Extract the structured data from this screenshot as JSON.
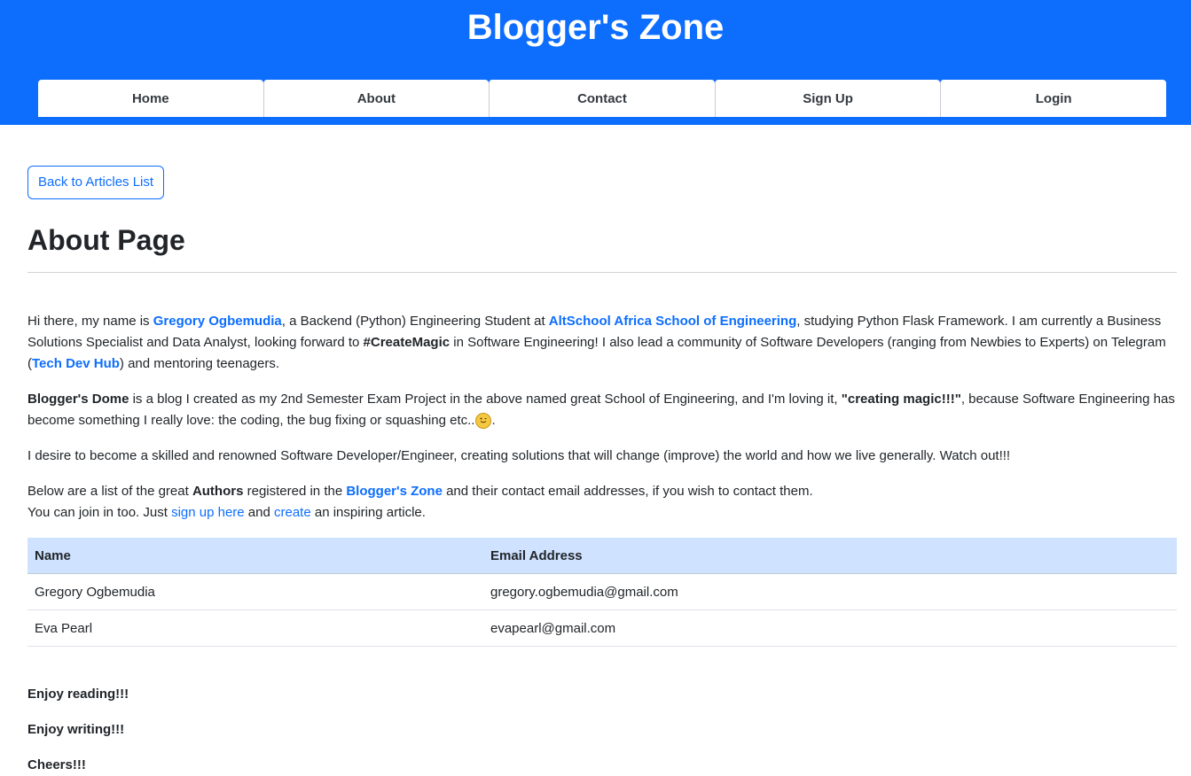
{
  "site": {
    "title": "Blogger's Zone",
    "brand_color": "#0d6efd"
  },
  "nav": {
    "items": [
      "Home",
      "About",
      "Contact",
      "Sign Up",
      "Login"
    ]
  },
  "back_button": "Back to Articles List",
  "page_title": "About Page",
  "intro": {
    "p1": {
      "t1": "Hi there, my name is ",
      "name_link": "Gregory Ogbemudia",
      "t2": ", a Backend (Python) Engineering Student at ",
      "school_link": "AltSchool Africa School of Engineering",
      "t3": ", studying Python Flask Framework. I am currently a Business Solutions Specialist and Data Analyst, looking forward to ",
      "hashtag": "#CreateMagic",
      "t4": " in Software Engineering! I also lead a community of Software Developers (ranging from Newbies to Experts) on Telegram (",
      "community_link": "Tech Dev Hub",
      "t5": ") and mentoring teenagers."
    },
    "p2": {
      "brand": "Blogger's Dome",
      "t1": " is a blog I created as my 2nd Semester Exam Project in the above named great School of Engineering, and I'm loving it, ",
      "quote": "\"creating magic!!!\"",
      "t2": ", because Software Engineering has become something I really love: the coding, the bug fixing or squashing etc..",
      "emoji": "😉",
      "t3": "."
    },
    "p3": "I desire to become a skilled and renowned Software Developer/Engineer, creating solutions that will change (improve) the world and how we live generally. Watch out!!!",
    "p4": {
      "t1": "Below are a list of the great ",
      "authors": "Authors",
      "t2": " registered in the ",
      "site_link": "Blogger's Zone",
      "t3": " and their contact email addresses, if you wish to contact them.",
      "t4": "You can join in too. Just ",
      "signup_link": "sign up here",
      "t5": " and ",
      "create_link": "create",
      "t6": " an inspiring article."
    }
  },
  "authors_table": {
    "headers": [
      "Name",
      "Email Address"
    ],
    "rows": [
      {
        "name": "Gregory Ogbemudia",
        "email": "gregory.ogbemudia@gmail.com"
      },
      {
        "name": "Eva Pearl",
        "email": "evapearl@gmail.com"
      }
    ]
  },
  "closing": {
    "c1": "Enjoy reading!!!",
    "c2": "Enjoy writing!!!",
    "c3": "Cheers!!!"
  }
}
